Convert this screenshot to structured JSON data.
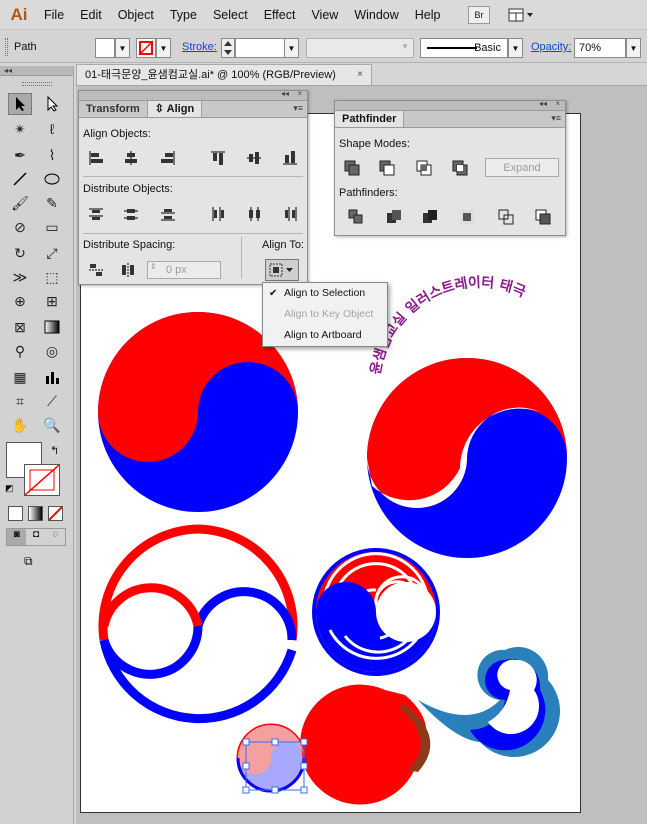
{
  "app": {
    "logo": "Ai"
  },
  "menu": [
    "File",
    "Edit",
    "Object",
    "Type",
    "Select",
    "Effect",
    "View",
    "Window",
    "Help"
  ],
  "menubar_buttons": {
    "bridge": "Br"
  },
  "control": {
    "selection_label": "Path",
    "stroke_label": "Stroke:",
    "stroke_profile": "Basic",
    "opacity_label": "Opacity:",
    "opacity_value": "70%"
  },
  "document": {
    "tab_title": "01-태극문양_윤샘컴교실.ai* @ 100% (RGB/Preview)",
    "close": "×"
  },
  "align_panel": {
    "tabs": [
      "Transform",
      "Align"
    ],
    "align_objects_label": "Align Objects:",
    "distribute_objects_label": "Distribute Objects:",
    "distribute_spacing_label": "Distribute Spacing:",
    "align_to_label": "Align To:",
    "spacing_value": "0 px"
  },
  "pathfinder_panel": {
    "tab": "Pathfinder",
    "shape_modes_label": "Shape Modes:",
    "pathfinders_label": "Pathfinders:",
    "expand_label": "Expand"
  },
  "align_to_menu": {
    "items": [
      {
        "label": "Align to Selection",
        "checked": true,
        "enabled": true
      },
      {
        "label": "Align to Key Object",
        "checked": false,
        "enabled": false
      },
      {
        "label": "Align to Artboard",
        "checked": false,
        "enabled": true
      }
    ]
  },
  "artwork": {
    "curved_text": "윤샘컴교실 일러스트레이터 태극"
  },
  "colors": {
    "red": "#ff0000",
    "blue": "#0000ff",
    "link": "#1a3fcf",
    "purple_text": "#8b1a8b"
  }
}
